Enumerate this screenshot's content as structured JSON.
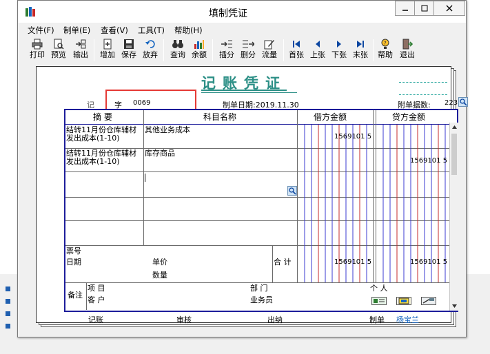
{
  "window": {
    "title": "填制凭证"
  },
  "menu": [
    "文件(F)",
    "制单(E)",
    "查看(V)",
    "工具(T)",
    "帮助(H)"
  ],
  "toolbar": [
    "打印",
    "预览",
    "输出",
    "增加",
    "保存",
    "放弃",
    "查询",
    "余额",
    "插分",
    "删分",
    "流量",
    "首张",
    "上张",
    "下张",
    "末张",
    "帮助",
    "退出"
  ],
  "voucher": {
    "title": "记账凭证",
    "type_label": "记",
    "zi_label": "字",
    "number": "0069",
    "date_label": "制单日期:2019.11.30",
    "attachments_label": "附单据数:",
    "attachments_value": "223",
    "columns": {
      "summary": "摘 要",
      "account": "科目名称",
      "debit": "借方金额",
      "credit": "贷方金额"
    },
    "rows": [
      {
        "summary_l1": "结转11月份仓库辅材",
        "summary_l2": "发出成本(1-10)",
        "account": "其他业务成本",
        "debit": "1569101 5",
        "credit": ""
      },
      {
        "summary_l1": "结转11月份仓库辅材",
        "summary_l2": "发出成本(1-10)",
        "account": "库存商品",
        "debit": "",
        "credit": "1569101 5"
      }
    ],
    "ticket_label": "票号",
    "date_field_label": "日期",
    "unit_price_label": "单价",
    "quantity_label": "数量",
    "total_label": "合 计",
    "total_debit": "1569101 5",
    "total_credit": "1569101 5",
    "remark_label": "备注",
    "project_label": "项  目",
    "customer_label": "客  户",
    "department_label": "部  门",
    "salesperson_label": "业务员",
    "person_label": "个  人"
  },
  "footer": {
    "bookkeeper_label": "记账",
    "reviewer_label": "审核",
    "cashier_label": "出纳",
    "maker_label": "制单",
    "maker_name": "杨宝兰"
  }
}
